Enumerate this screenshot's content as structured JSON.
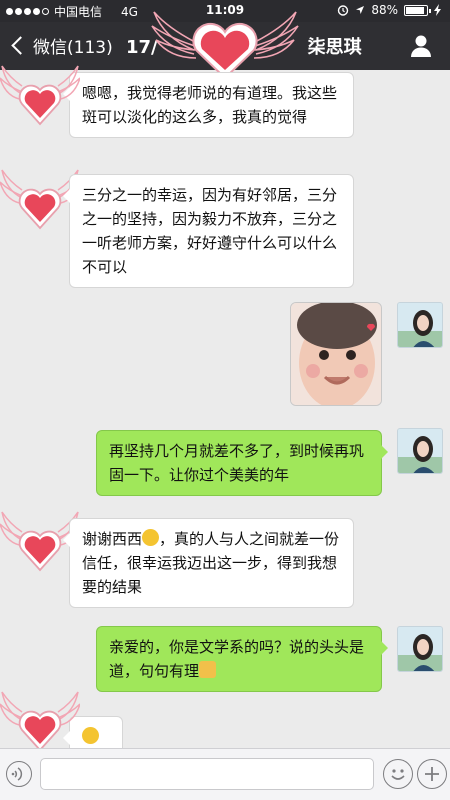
{
  "status_bar": {
    "carrier": "中国电信",
    "network": "4G",
    "time": "11:09",
    "battery": "88%",
    "battery_level": 0.88
  },
  "nav": {
    "back_label": "微信(113)",
    "title_prefix": "17/",
    "title_suffix": "柒思琪"
  },
  "messages": [
    {
      "side": "in",
      "text": "嗯嗯，我觉得老师说的有道理。我这些斑可以淡化的这么多，我真的觉得"
    },
    {
      "side": "in",
      "text": "三分之一的幸运，因为有好邻居，三分之一的坚持，因为毅力不放弃，三分之一听老师方案，好好遵守什么可以什么不可以"
    },
    {
      "side": "out",
      "type": "image",
      "alt": "baby photo"
    },
    {
      "side": "out",
      "text": "再坚持几个月就差不多了，到时候再巩固一下。让你过个美美的年"
    },
    {
      "side": "in",
      "text_a": "谢谢西西",
      "text_b": "，真的人与人之间就差一份信任，很幸运我迈出这一步，得到我想要的结果"
    },
    {
      "side": "out",
      "text": "亲爱的，你是文学系的吗？说的头头是道，句句有理"
    },
    {
      "side": "in",
      "type": "emoji"
    }
  ],
  "input": {
    "placeholder": ""
  },
  "colors": {
    "outgoing_bubble": "#a0e75a",
    "incoming_bubble": "#ffffff",
    "nav_bg": "#2f2f33",
    "heart": "#e8475a"
  }
}
